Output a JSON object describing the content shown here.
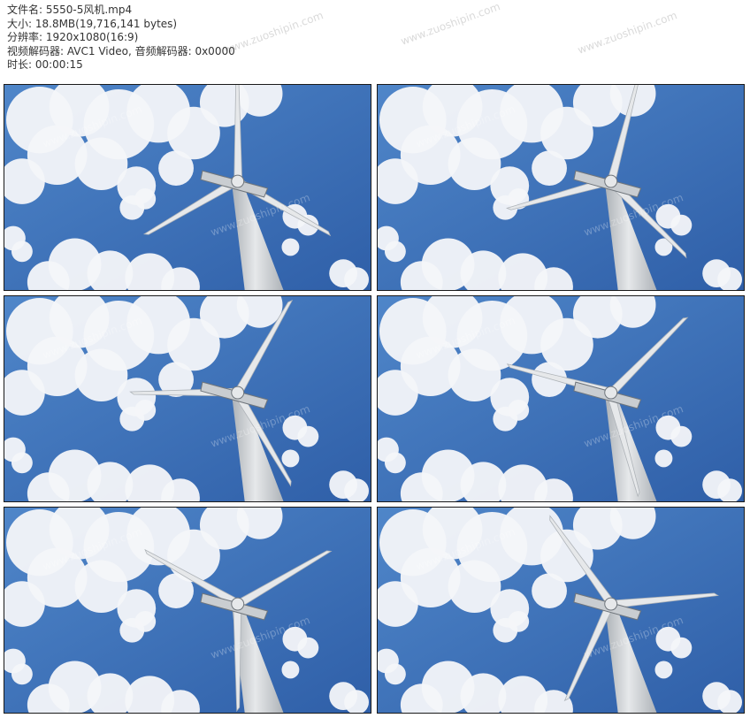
{
  "file_info": {
    "filename": "文件名: 5550-5风机.mp4",
    "size": "大小: 18.8MB(19,716,141 bytes)",
    "resolution": "分辨率: 1920x1080(16:9)",
    "codec": "视频解码器: AVC1 Video, 音频解码器: 0x0000",
    "duration": "时长: 00:00:15"
  },
  "watermark": "www.zuoshipin.com",
  "colors": {
    "sky_top": "#2f5fa8",
    "sky_bottom": "#4f86c9",
    "cloud": "#f4f6f9",
    "turbine": "#e6e8ea",
    "turbine_shade": "#aeb3b8"
  },
  "frames": [
    {
      "rotation": 0
    },
    {
      "rotation": 15
    },
    {
      "rotation": 30
    },
    {
      "rotation": 45
    },
    {
      "rotation": 60
    },
    {
      "rotation": 85
    }
  ]
}
